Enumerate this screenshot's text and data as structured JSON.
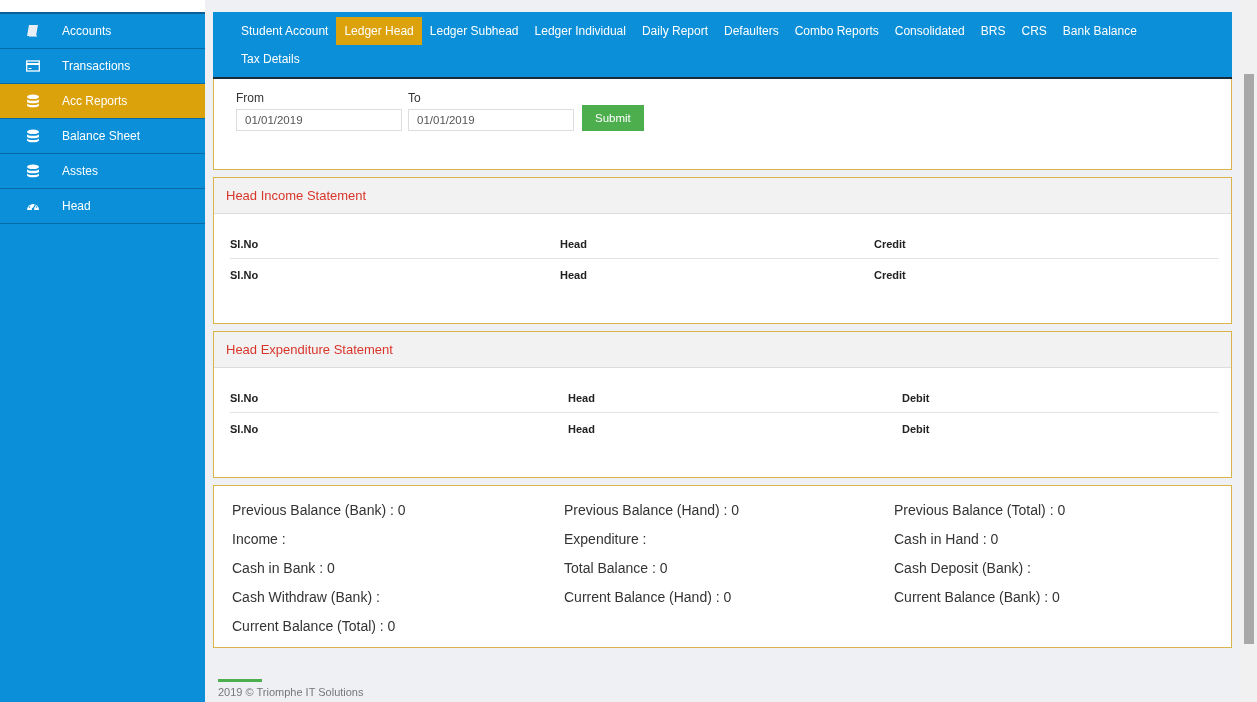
{
  "sidebar": {
    "items": [
      {
        "label": "Accounts",
        "kind": "book",
        "selected": false
      },
      {
        "label": "Transactions",
        "kind": "card",
        "selected": false
      },
      {
        "label": "Acc Reports",
        "kind": "database",
        "selected": true
      },
      {
        "label": "Balance Sheet",
        "kind": "database",
        "selected": false
      },
      {
        "label": "Asstes",
        "kind": "database",
        "selected": false
      },
      {
        "label": "Head",
        "kind": "gauge",
        "selected": false
      }
    ]
  },
  "tabs": [
    {
      "label": "Student Account",
      "selected": false
    },
    {
      "label": "Ledger Head",
      "selected": true
    },
    {
      "label": "Ledger Subhead",
      "selected": false
    },
    {
      "label": "Ledger Individual",
      "selected": false
    },
    {
      "label": "Daily Report",
      "selected": false
    },
    {
      "label": "Defaulters",
      "selected": false
    },
    {
      "label": "Combo Reports",
      "selected": false
    },
    {
      "label": "Consolidated",
      "selected": false
    },
    {
      "label": "BRS",
      "selected": false
    },
    {
      "label": "CRS",
      "selected": false
    },
    {
      "label": "Bank Balance",
      "selected": false
    },
    {
      "label": "Tax Details",
      "selected": false
    }
  ],
  "filter": {
    "from": {
      "label": "From",
      "value": "01/01/2019"
    },
    "to": {
      "label": "To",
      "value": "01/01/2019"
    },
    "submit": "Submit"
  },
  "statements": [
    {
      "title": "Head Income Statement",
      "rows": [
        [
          "Sl.No",
          "Head",
          "Credit"
        ],
        [
          "Sl.No",
          "Head",
          "Credit"
        ]
      ]
    },
    {
      "title": "Head Expenditure Statement",
      "rows": [
        [
          "Sl.No",
          "Head",
          "Debit"
        ],
        [
          "Sl.No",
          "Head",
          "Debit"
        ]
      ]
    }
  ],
  "summary": {
    "items": [
      "Previous Balance (Bank) : 0",
      "Previous Balance (Hand) : 0",
      "Previous Balance (Total) : 0",
      "Income :",
      "Expenditure :",
      "Cash in Hand : 0",
      "Cash in Bank : 0",
      "Total Balance : 0",
      "Cash Deposit (Bank) :",
      "Cash Withdraw (Bank) :",
      "Current Balance (Hand) : 0",
      "Current Balance (Bank) : 0",
      "Current Balance (Total) : 0"
    ]
  },
  "footer": {
    "text": "2019 © Triomphe IT Solutions"
  }
}
